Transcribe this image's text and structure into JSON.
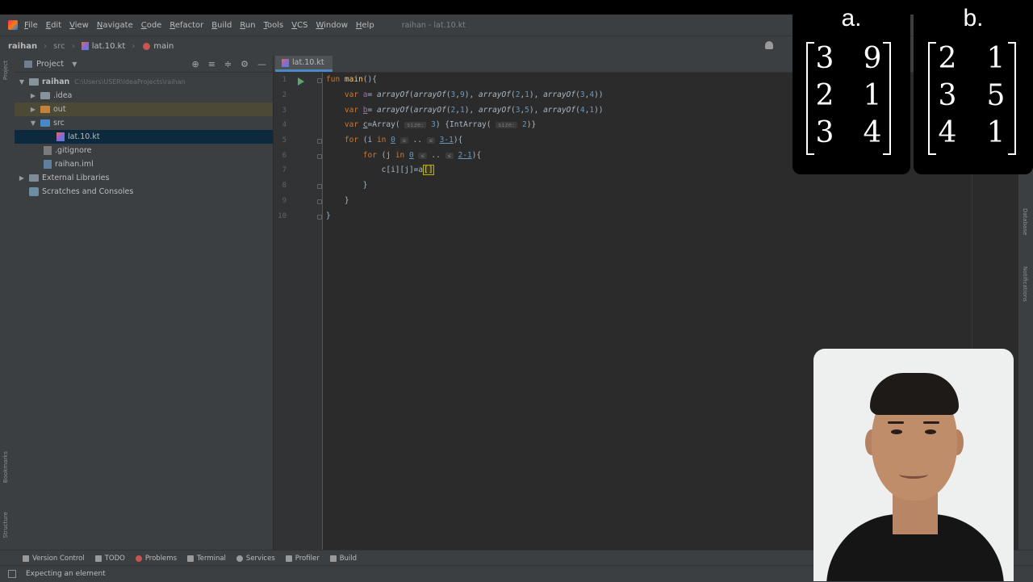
{
  "menu": {
    "items": [
      "File",
      "Edit",
      "View",
      "Navigate",
      "Code",
      "Refactor",
      "Build",
      "Run",
      "Tools",
      "VCS",
      "Window",
      "Help"
    ],
    "window_title": "raihan - lat.10.kt"
  },
  "navbar": {
    "project": "raihan",
    "folder": "src",
    "file": "lat.10.kt",
    "function": "main"
  },
  "project_panel": {
    "title": "Project",
    "tree": {
      "root_name": "raihan",
      "root_path": "C:\\Users\\USER\\IdeaProjects\\raihan",
      "idea": ".idea",
      "out": "out",
      "src": "src",
      "kt_file": "lat.10.kt",
      "gitignore": ".gitignore",
      "iml": "raihan.iml",
      "external_libraries": "External Libraries",
      "scratches": "Scratches and Consoles"
    }
  },
  "editor": {
    "tab_label": "lat.10.kt",
    "line_numbers": [
      "1",
      "2",
      "3",
      "4",
      "5",
      "6",
      "7",
      "8",
      "9",
      "10"
    ],
    "hints": {
      "size": "size:"
    }
  },
  "left_strip": {
    "project": "Project",
    "bookmarks": "Bookmarks",
    "structure": "Structure"
  },
  "right_strip": {
    "database": "Database",
    "notifications": "Notifications"
  },
  "tool_windows": [
    "Version Control",
    "TODO",
    "Problems",
    "Terminal",
    "Services",
    "Profiler",
    "Build"
  ],
  "status_bar": {
    "message": "Expecting an element"
  },
  "matrices": {
    "a": {
      "label": "a.",
      "rows": [
        [
          "3",
          "9"
        ],
        [
          "2",
          "1"
        ],
        [
          "3",
          "4"
        ]
      ]
    },
    "b": {
      "label": "b.",
      "rows": [
        [
          "2",
          "1"
        ],
        [
          "3",
          "5"
        ],
        [
          "4",
          "1"
        ]
      ]
    }
  }
}
